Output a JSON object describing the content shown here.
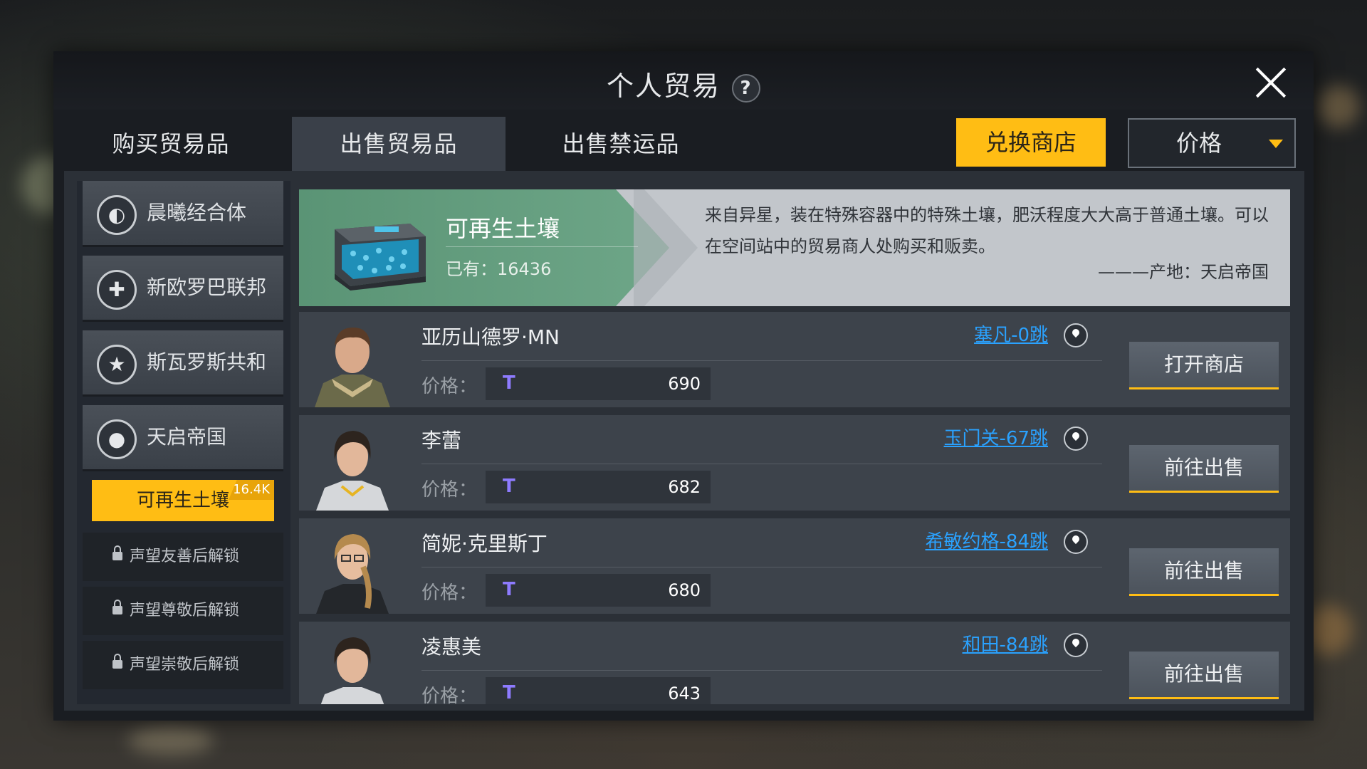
{
  "window": {
    "title": "个人贸易"
  },
  "tabs": [
    {
      "label": "购买贸易品",
      "active": false
    },
    {
      "label": "出售贸易品",
      "active": true
    },
    {
      "label": "出售禁运品",
      "active": false
    }
  ],
  "exchange_button": "兑换商店",
  "sort": {
    "selected": "价格"
  },
  "factions": [
    {
      "name": "晨曦经合体",
      "icon": "eye-emblem-icon"
    },
    {
      "name": "新欧罗巴联邦",
      "icon": "cross-emblem-icon"
    },
    {
      "name": "斯瓦罗斯共和国",
      "icon": "star-emblem-icon"
    },
    {
      "name": "天启帝国",
      "icon": "planet-emblem-icon"
    }
  ],
  "active_item": {
    "label": "可再生土壤",
    "badge": "16.4K"
  },
  "locked_items": [
    {
      "label": "声望友善后解锁"
    },
    {
      "label": "声望尊敬后解锁"
    },
    {
      "label": "声望崇敬后解锁"
    }
  ],
  "product": {
    "name": "可再生土壤",
    "owned": "已有：16436",
    "description": "来自异星，装在特殊容器中的特殊土壤，肥沃程度大大高于普通土壤。可以在空间站中的贸易商人处购买和贩卖。",
    "origin": "———产地：天启帝国"
  },
  "price_label": "价格：",
  "traders": [
    {
      "name": "亚历山德罗·MN",
      "location": "塞凡-0跳",
      "price": "690",
      "action": "打开商店"
    },
    {
      "name": "李蕾",
      "location": "玉门关-67跳",
      "price": "682",
      "action": "前往出售"
    },
    {
      "name": "简妮·克里斯丁",
      "location": "希敏约格-84跳",
      "price": "680",
      "action": "前往出售"
    },
    {
      "name": "凌惠美",
      "location": "和田-84跳",
      "price": "643",
      "action": "前往出售"
    }
  ],
  "colors": {
    "accent": "#ffbd14",
    "link": "#2aa2ff",
    "banner_green": "#5a9475",
    "currency": "#8e7bff"
  }
}
